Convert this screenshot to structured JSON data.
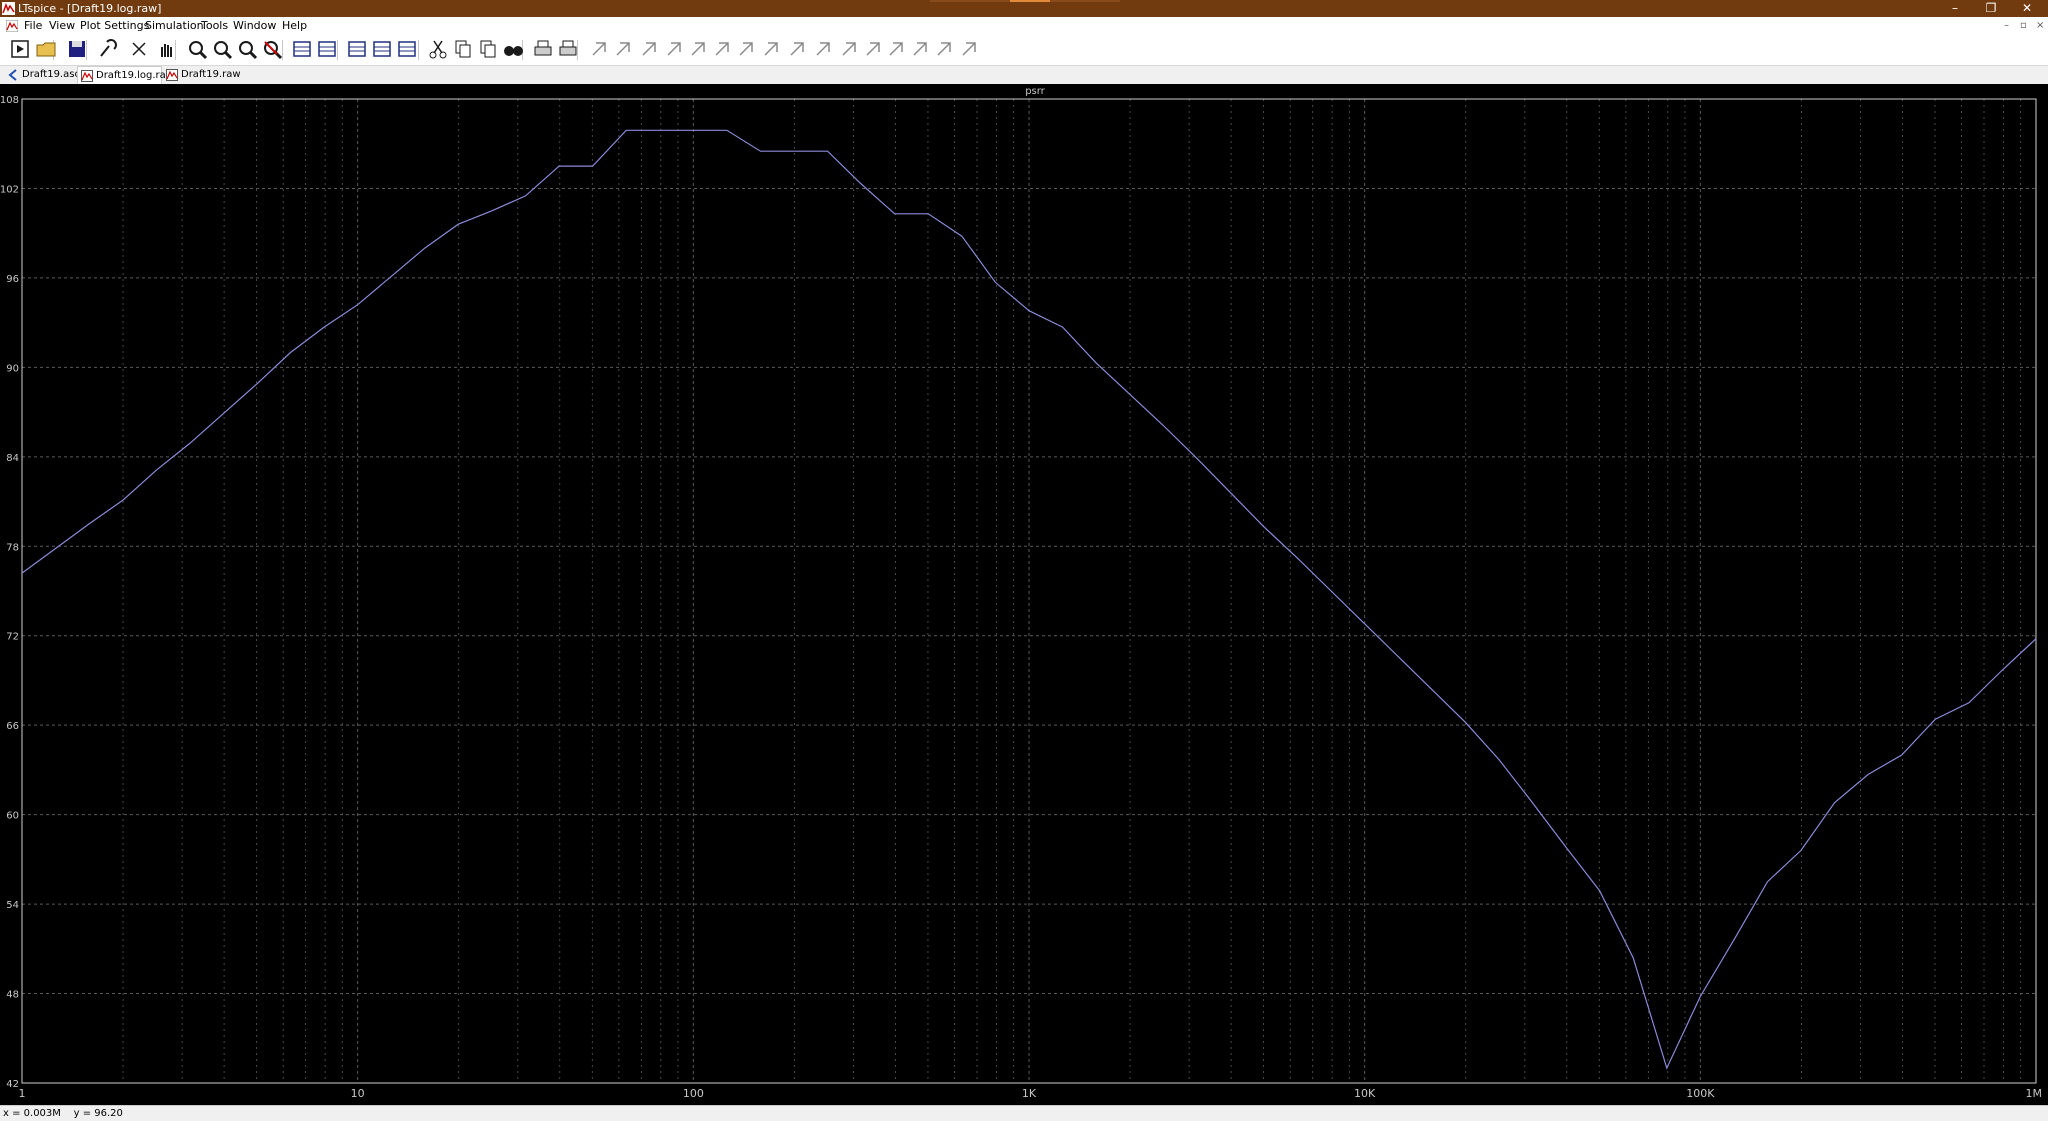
{
  "titlebar": {
    "title": "LTspice - [Draft19.log.raw]",
    "minimize": "–",
    "restore": "❐",
    "close": "✕"
  },
  "menu": {
    "items": [
      "File",
      "View",
      "Plot Settings",
      "Simulation",
      "Tools",
      "Window",
      "Help"
    ],
    "mdi_controls": [
      "–",
      "▫",
      "×"
    ]
  },
  "toolbar": {
    "icons": [
      "run-icon",
      "open-icon",
      "save-icon",
      "control-panel-icon",
      "halt-icon",
      "hand-icon",
      "zoom-in-icon",
      "zoom-full-icon",
      "zoom-out-icon",
      "zoom-cancel-icon",
      "autorange-icon",
      "zoom-box-icon",
      "tile-horizontal-icon",
      "tile-vertical-icon",
      "cascade-icon",
      "cut-icon",
      "copy-icon",
      "paste-icon",
      "find-icon",
      "print-icon",
      "print-setup-icon",
      "wire-icon",
      "ground-icon",
      "label-icon",
      "resistor-icon",
      "capacitor-icon",
      "inductor-icon",
      "diode-icon",
      "component-icon",
      "move-icon",
      "drag-icon",
      "undo-icon",
      "redo-icon",
      "rotate-icon",
      "mirror-icon",
      "text-icon",
      "spice-directive-icon"
    ]
  },
  "tabs": [
    {
      "label": "Draft19.asc",
      "icon": "schematic-icon",
      "active": false
    },
    {
      "label": "Draft19.log.raw",
      "icon": "waveform-icon",
      "active": true
    },
    {
      "label": "Draft19.raw",
      "icon": "waveform-icon",
      "active": false
    }
  ],
  "status": {
    "text": "x = 0.003M    y = 96.20"
  },
  "colors": {
    "titlebar": "#713b0f",
    "plot_background": "#000000",
    "grid": "#5a5a5a",
    "trace": "#8a8ad8",
    "axis_text": "#c8c8c8"
  },
  "chart_data": {
    "type": "line",
    "title": "psrr",
    "xlabel": "",
    "ylabel": "",
    "xscale": "log",
    "xlim": [
      1,
      1000000
    ],
    "ylim": [
      42,
      108
    ],
    "x_tick_labels": [
      "1",
      "10",
      "100",
      "1K",
      "10K",
      "100K",
      "1M"
    ],
    "y_ticks": [
      42,
      48,
      54,
      60,
      66,
      72,
      78,
      84,
      90,
      96,
      102,
      108
    ],
    "grid": true,
    "series": [
      {
        "name": "psrr",
        "x": [
          1,
          1.585,
          2,
          2.512,
          3.162,
          3.981,
          5.012,
          6.31,
          7.943,
          10,
          12.59,
          15.85,
          19.95,
          25.12,
          31.62,
          39.81,
          50.12,
          63.1,
          79.43,
          100,
          125.9,
          158.5,
          199.5,
          251.2,
          316.2,
          398.1,
          501.2,
          631,
          794.3,
          1000,
          1259,
          1585,
          1995,
          2512,
          3162,
          3981,
          5012,
          6310,
          7943,
          10000,
          12590,
          15850,
          19950,
          25120,
          31620,
          39810,
          50120,
          63100,
          79430,
          100000,
          125900,
          158500,
          199500,
          251200,
          316200,
          398100,
          501200,
          631000,
          794300,
          1000000
        ],
        "y": [
          76.2,
          79.5,
          81.1,
          83.1,
          84.9,
          86.9,
          88.9,
          91.0,
          92.7,
          94.2,
          96.1,
          98.0,
          99.6,
          100.5,
          101.5,
          103.5,
          103.5,
          105.9,
          105.9,
          105.9,
          105.9,
          104.5,
          104.5,
          104.5,
          102.3,
          100.3,
          100.3,
          98.8,
          95.7,
          93.8,
          92.7,
          90.3,
          88.2,
          86.1,
          83.9,
          81.6,
          79.3,
          77.2,
          75.0,
          72.8,
          70.6,
          68.4,
          66.2,
          63.7,
          60.8,
          57.8,
          54.9,
          50.4,
          43.0,
          47.8,
          51.6,
          55.5,
          57.6,
          60.8,
          62.7,
          64.0,
          66.4,
          67.5,
          69.7,
          71.8
        ]
      }
    ]
  }
}
